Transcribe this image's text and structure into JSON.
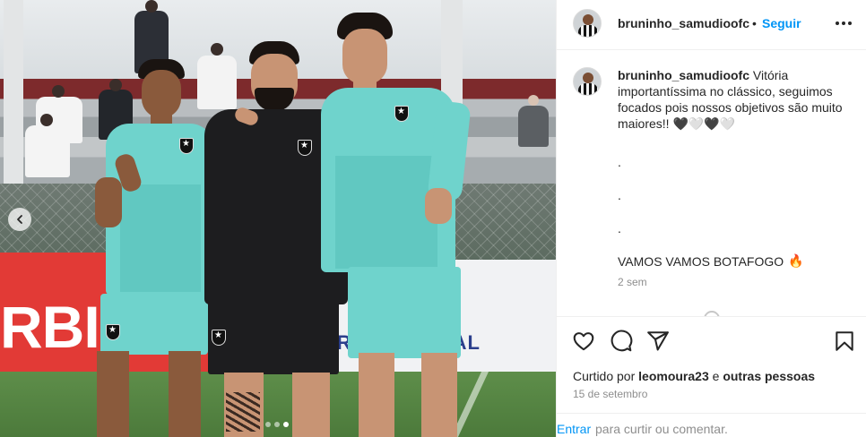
{
  "post": {
    "username": "bruninho_samudioofc",
    "separator": "•",
    "follow_label": "Seguir",
    "more_icon": "more-options-icon"
  },
  "photo": {
    "banner_left_text": "RBI",
    "banner_right_text": "PROMOTIONAL",
    "carousel_dots": 3,
    "active_dot": 3
  },
  "caption": {
    "username": "bruninho_samudioofc",
    "text": "Vitória importantíssima no clássico, seguimos focados pois nossos objetivos são muito maiores!!",
    "hearts": [
      "🖤",
      "🤍",
      "🖤",
      "🤍"
    ],
    "dot_lines": [
      ".",
      ".",
      "."
    ],
    "final_line": "VAMOS VAMOS BOTAFOGO",
    "final_emoji": "🔥",
    "time_ago": "2 sem"
  },
  "actions": {
    "like_icon": "heart-icon",
    "comment_icon": "comment-icon",
    "share_icon": "share-icon",
    "save_icon": "bookmark-icon"
  },
  "likes": {
    "prefix": "Curtido por",
    "user": "leomoura23",
    "connector": "e",
    "others": "outras pessoas"
  },
  "date": "15 de setembro",
  "comment": {
    "link_label": "Entrar",
    "rest_text": "para curtir ou comentar."
  },
  "colors": {
    "accent": "#0095f6",
    "muted": "#8e8e8e",
    "text": "#262626",
    "jersey": "#6fd3cc"
  }
}
